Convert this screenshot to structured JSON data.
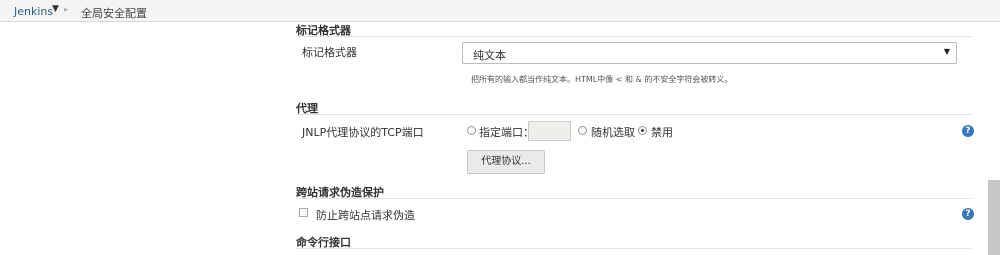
{
  "breadcrumb": {
    "root": "Jenkins",
    "caret": "▼",
    "separator": "▸",
    "current": "全局安全配置"
  },
  "markup_formatter": {
    "section_title": "标记格式器",
    "field_label": "标记格式器",
    "selected_value": "纯文本",
    "dropdown_arrow": "▼",
    "help_text": "把所有的输入都当作纯文本。HTML中像 < 和 & 的不安全字符会被转义。"
  },
  "proxy": {
    "section_title": "代理",
    "tcp_port_label": "JNLP代理协议的TCP端口",
    "options": [
      {
        "label": "指定端口：",
        "checked": false
      },
      {
        "label": "随机选取",
        "checked": false
      },
      {
        "label": "禁用",
        "checked": true
      }
    ],
    "port_value": "",
    "protocols_button": "代理协议..."
  },
  "csrf": {
    "section_title": "跨站请求伪造保护",
    "checkbox_label": "防止跨站点请求伪造",
    "checked": false
  },
  "cli": {
    "section_title": "命令行接口"
  },
  "help_icon_glyph": "?",
  "colors": {
    "link": "#2c5f8a",
    "help_icon": "#3b76b8",
    "breadcrumb_bg": "#f4f4f4"
  }
}
